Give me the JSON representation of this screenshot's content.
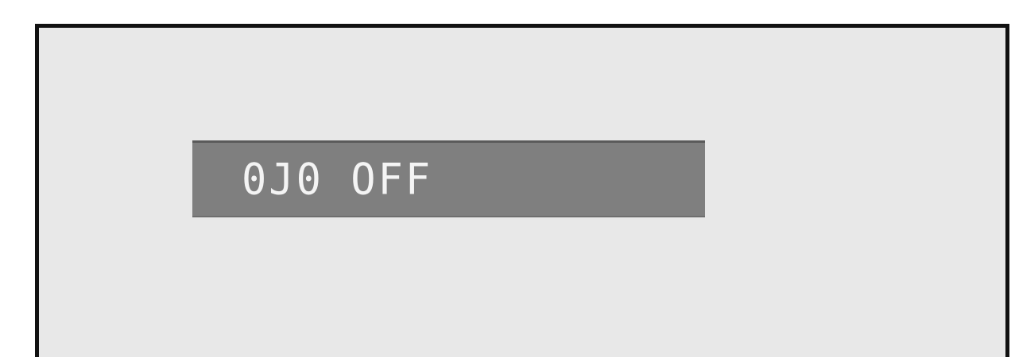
{
  "osd": {
    "message": "0J0 OFF"
  },
  "colors": {
    "screen_background": "#e8e8e8",
    "frame_border": "#111111",
    "osd_bar_background": "#7f7f7f",
    "osd_text": "#f4f4f4"
  }
}
